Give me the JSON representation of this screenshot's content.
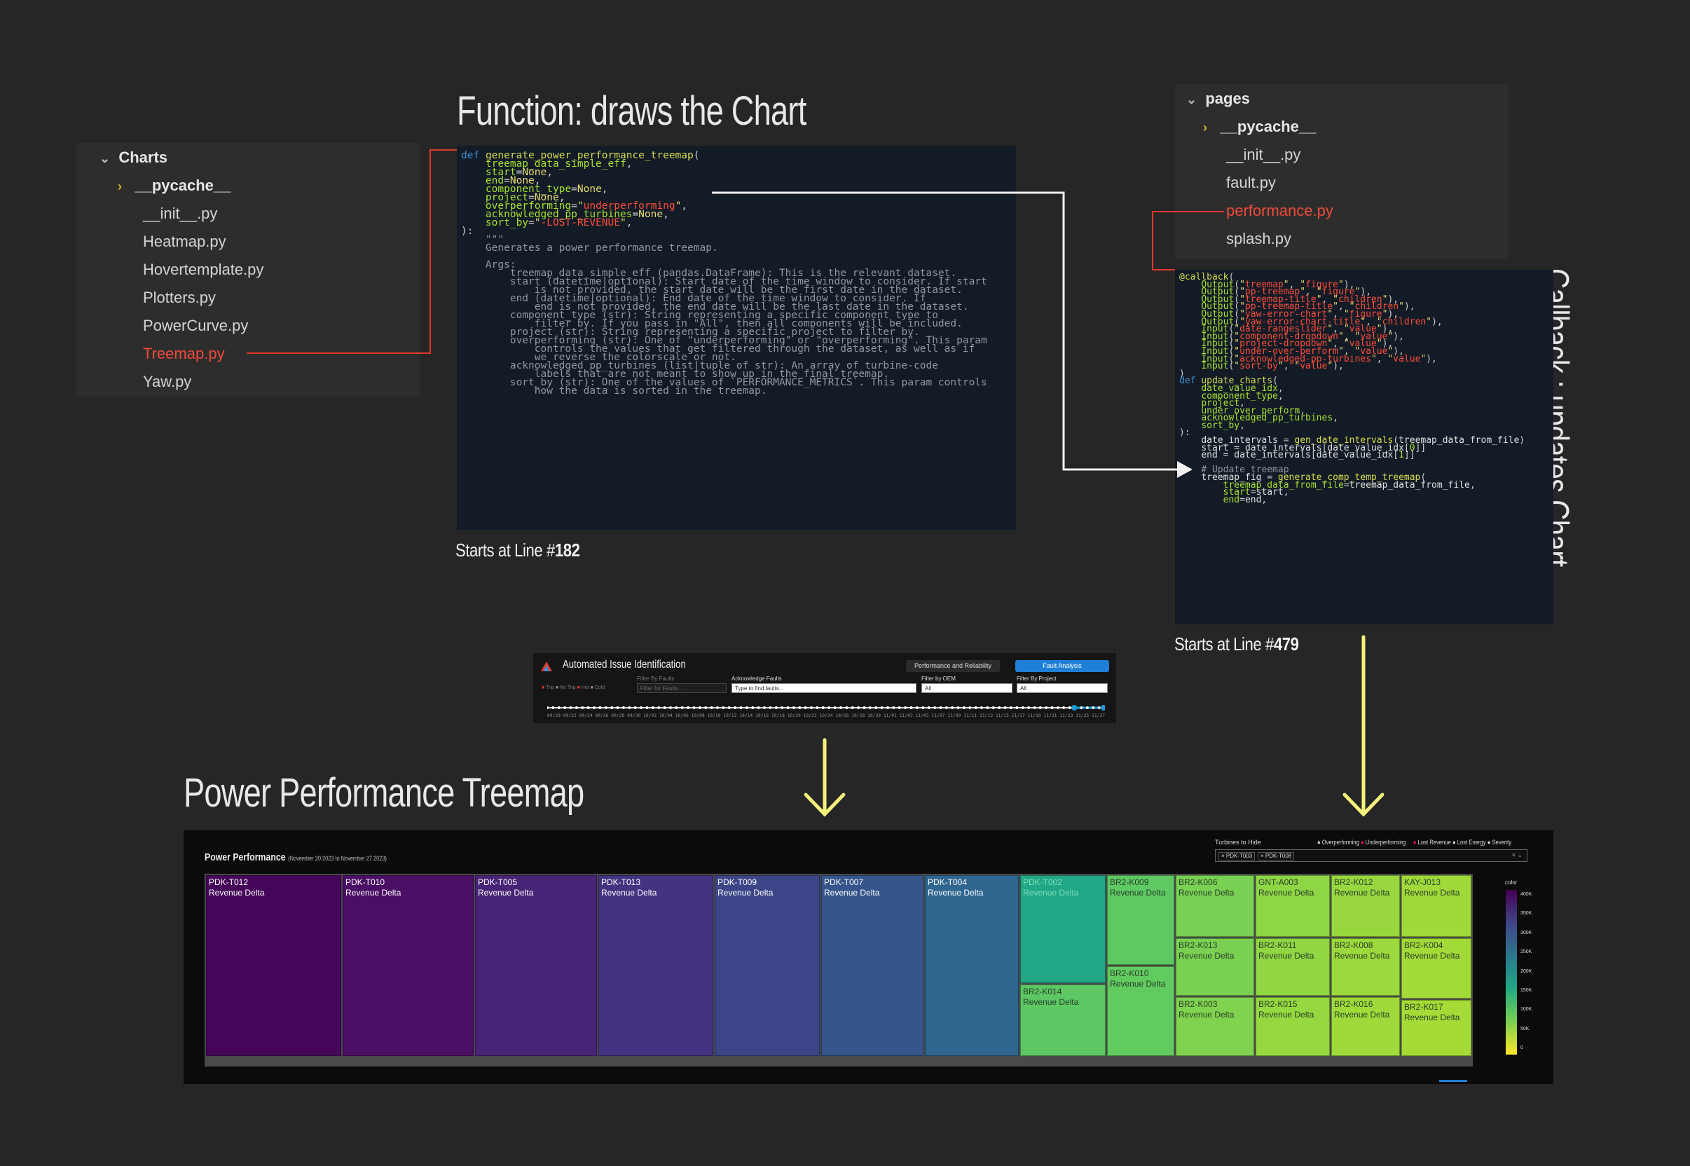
{
  "headings": {
    "function_title": "Function: draws the Chart",
    "treemap_title": "Power Performance Treemap",
    "callback_title": "Callback : updates Chart"
  },
  "captions": {
    "left_prefix": "Starts at Line #",
    "left_line": "182",
    "right_prefix": "Starts at Line #",
    "right_line": "479"
  },
  "charts_explorer": {
    "folder": "Charts",
    "items": [
      "__pycache__",
      "__init__.py",
      "Heatmap.py",
      "Hovertemplate.py",
      "Plotters.py",
      "PowerCurve.py",
      "Treemap.py",
      "Yaw.py"
    ],
    "highlighted": "Treemap.py"
  },
  "pages_explorer": {
    "folder": "pages",
    "items": [
      "__pycache__",
      "__init__.py",
      "fault.py",
      "performance.py",
      "splash.py"
    ],
    "highlighted": "performance.py"
  },
  "dashboard": {
    "title": "Automated Issue Identification",
    "tab_performance": "Performance and Reliability",
    "tab_fault": "Fault Analysis",
    "legend_items": [
      "Trip",
      "No Trip",
      "Hot",
      "Cold"
    ],
    "filter_faults_label": "Filter By Faults",
    "filter_faults_placeholder": "Filter for Faults...",
    "ack_label": "Acknowledge Faults",
    "ack_placeholder": "Type to find faults...",
    "oem_label": "Filter by OEM",
    "oem_value": "All",
    "project_label": "Filter By Project",
    "project_value": "All",
    "slider_selected_range": [
      0.945,
      1.0
    ]
  },
  "treemap": {
    "title": "Power Performance",
    "date_range": "(November 20 2023 to November 27 2023)",
    "turbines_to_hide_label": "Turbines to Hide",
    "hidden_turbines": [
      "PDK-T003",
      "PDK-T008"
    ],
    "radio_overperforming": "Overperforming",
    "radio_underperforming": "Underperforming",
    "radio_lost_revenue": "Lost Revenue",
    "radio_lost_energy": "Lost Energy",
    "radio_severity": "Severity",
    "colorbar_title": "color",
    "colorbar_ticks": [
      "400K",
      "350K",
      "300K",
      "250K",
      "200K",
      "150K",
      "100K",
      "50K",
      "0"
    ],
    "tile_sublabel": "Revenue Delta",
    "tiles": [
      {
        "name": "PDK-T012",
        "color": "#45065a"
      },
      {
        "name": "PDK-T010",
        "color": "#4a0e64"
      },
      {
        "name": "PDK-T005",
        "color": "#482476"
      },
      {
        "name": "PDK-T013",
        "color": "#433381"
      },
      {
        "name": "PDK-T009",
        "color": "#3c4587"
      },
      {
        "name": "PDK-T007",
        "color": "#35558b"
      },
      {
        "name": "PDK-T004",
        "color": "#2f6690"
      },
      {
        "name": "PDK-T002",
        "color": "#21a686"
      },
      {
        "name": "BR2-K014",
        "color": "#5cc763"
      },
      {
        "name": "BR2-K009",
        "color": "#5ec962"
      },
      {
        "name": "BR2-K010",
        "color": "#62cb5f"
      },
      {
        "name": "BR2-K006",
        "color": "#78d152"
      },
      {
        "name": "BR2-K013",
        "color": "#7ad151"
      },
      {
        "name": "BR2-K003",
        "color": "#80d34e"
      },
      {
        "name": "GNT-A003",
        "color": "#8ed645"
      },
      {
        "name": "BR2-K011",
        "color": "#90d743"
      },
      {
        "name": "BR2-K015",
        "color": "#95d840"
      },
      {
        "name": "BR2-K012",
        "color": "#98d83e"
      },
      {
        "name": "BR2-K008",
        "color": "#9bd93c"
      },
      {
        "name": "BR2-K016",
        "color": "#9fda3a"
      },
      {
        "name": "KAY-J013",
        "color": "#9fda3a"
      },
      {
        "name": "BR2-K004",
        "color": "#a2da37"
      },
      {
        "name": "BR2-K017",
        "color": "#a5db36"
      }
    ]
  },
  "colors": {
    "red_highlight": "#f04a3a",
    "arrow_yellow": "#f6f27c",
    "fault_tab_blue": "#1f7fd6"
  }
}
